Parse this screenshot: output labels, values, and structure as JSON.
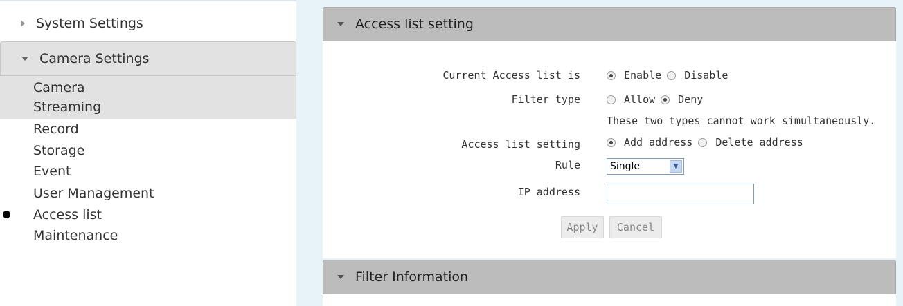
{
  "sidebar": {
    "system_settings": "System Settings",
    "camera_settings": "Camera Settings",
    "items": [
      {
        "label": "Camera"
      },
      {
        "label": "Streaming"
      },
      {
        "label": "Record"
      },
      {
        "label": "Storage"
      },
      {
        "label": "Event"
      },
      {
        "label": "User Management"
      },
      {
        "label": "Access list"
      },
      {
        "label": "Maintenance"
      }
    ],
    "active_item": "Access list"
  },
  "access_panel": {
    "title": "Access list setting",
    "current_label": "Current Access list is",
    "enable_label": "Enable",
    "disable_label": "Disable",
    "current_value": "Enable",
    "filter_label": "Filter type",
    "allow_label": "Allow",
    "deny_label": "Deny",
    "filter_value": "Deny",
    "filter_note": "These two types cannot work simultaneously.",
    "setting_label": "Access list setting",
    "add_label": "Add address",
    "delete_label": "Delete address",
    "setting_value": "Add address",
    "rule_label": "Rule",
    "rule_value": "Single",
    "ip_label": "IP address",
    "ip_value": "",
    "apply_label": "Apply",
    "cancel_label": "Cancel"
  },
  "filter_panel": {
    "title": "Filter Information"
  },
  "colors": {
    "panel_header": "#bcbcbc",
    "sidebar_active": "#e2e2e2",
    "background": "#e8f3f8"
  }
}
